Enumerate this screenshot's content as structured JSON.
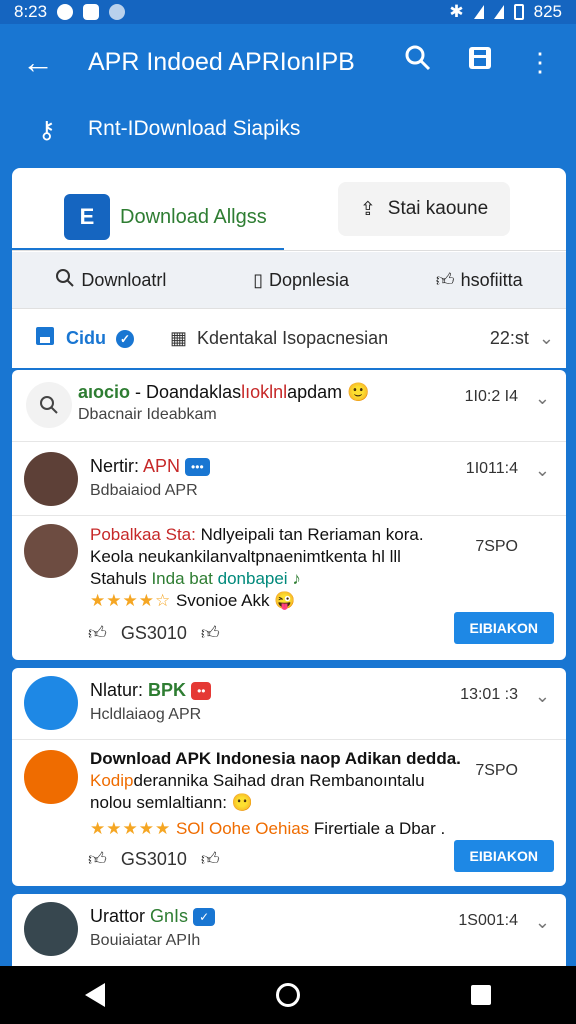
{
  "status": {
    "time": "8:23",
    "battery": "825"
  },
  "appbar": {
    "title": "APR Indoed APRIonIPB",
    "subtitle": "Rnt-IDownload Siapiks",
    "icons": {
      "back": "back-arrow-icon",
      "search": "search-icon",
      "save": "save-icon",
      "more": "more-vert-icon"
    }
  },
  "tabs": {
    "main_label": "Download Allgss",
    "main_logo": "E",
    "second_label": "Stai kaoune",
    "subtabs": [
      "Downloatrl",
      "Dopnlesia",
      "hsofiitta"
    ]
  },
  "filter": {
    "left_label": "Cidu",
    "middle_label": "Kdentakal Isopacnesian",
    "time": "22:st"
  },
  "search_row": {
    "title_accent": "aıocio",
    "title_main": "- Doandaklas",
    "title_red": "lıoklnl",
    "title_tail": "apdam",
    "subtitle": "Dbacnair Ideabkam",
    "time": "1I0:2 I4"
  },
  "card1": {
    "row1": {
      "name": "Nertir:",
      "name_red": "APN",
      "subtitle": "Bdbaiaiod APR",
      "time": "1I011:4"
    },
    "row2": {
      "line1_red": "Pobalkaa Sta:",
      "line1": "Ndlyeipali tan Reriaman kora.",
      "line2": "Keola neukankilanvaltpnaenimtkenta hl lll",
      "line3": "Stahuls",
      "line3_green": "Inda bat",
      "line3_teal": "donbapei",
      "rating_text": "Svonioe Akk",
      "time": "7SPO",
      "likes": "GS3010",
      "button": "EIBIAKON"
    }
  },
  "card2": {
    "row1": {
      "name": "Nlatur:",
      "name_green": "BPK",
      "subtitle": "Hcldlaiaog APR",
      "time": "13:01 :3"
    },
    "row2": {
      "line1": "Download APK Indonesia naop Adikan dedda.",
      "line2_orange": "Kodip",
      "line2": "derannika Saihad dran Rembanoıntalu",
      "line3": "nolou semlaltiann:",
      "rating_orange": "SOl Oohe Oehias",
      "rating_text": "Firertiale a Dbar .",
      "time": "7SPO",
      "likes": "GS3010",
      "button": "EIBIAKON"
    }
  },
  "card3": {
    "row1": {
      "name": "Urattor",
      "name_green": "GnIs",
      "subtitle": "Bouiaiatar APIh",
      "time": "1S001:4"
    }
  },
  "colors": {
    "primary": "#1976d2",
    "accent_green": "#2e7d32",
    "accent_red": "#c62828",
    "star": "#f5a623",
    "button": "#1e88e5"
  }
}
